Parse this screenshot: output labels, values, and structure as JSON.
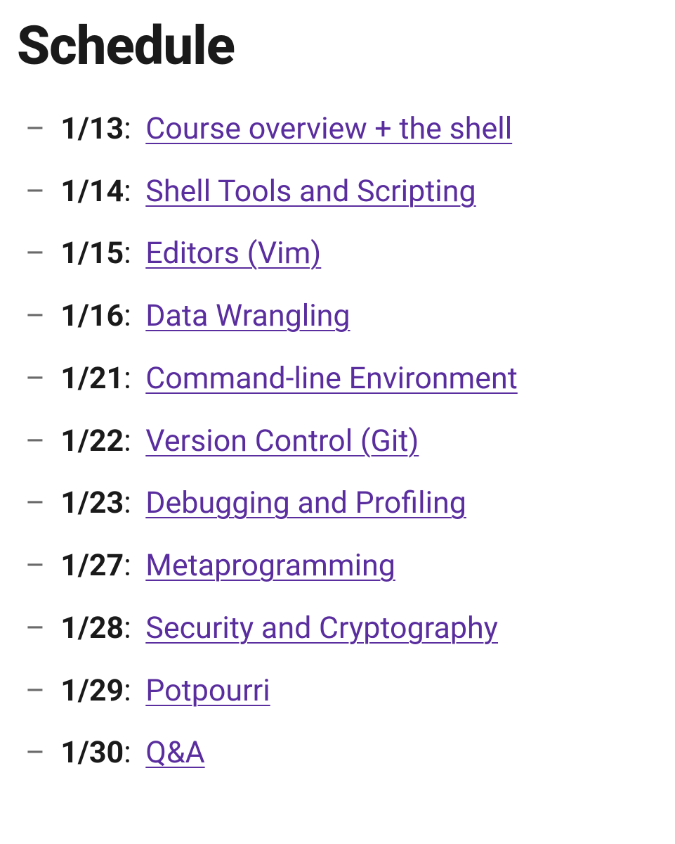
{
  "heading": "Schedule",
  "items": [
    {
      "date": "1/13",
      "title": "Course overview + the shell"
    },
    {
      "date": "1/14",
      "title": "Shell Tools and Scripting"
    },
    {
      "date": "1/15",
      "title": "Editors (Vim)"
    },
    {
      "date": "1/16",
      "title": "Data Wrangling"
    },
    {
      "date": "1/21",
      "title": "Command-line Environment"
    },
    {
      "date": "1/22",
      "title": "Version Control (Git)"
    },
    {
      "date": "1/23",
      "title": "Debugging and Profiling"
    },
    {
      "date": "1/27",
      "title": "Metaprogramming"
    },
    {
      "date": "1/28",
      "title": "Security and Cryptography"
    },
    {
      "date": "1/29",
      "title": "Potpourri"
    },
    {
      "date": "1/30",
      "title": "Q&A"
    }
  ]
}
